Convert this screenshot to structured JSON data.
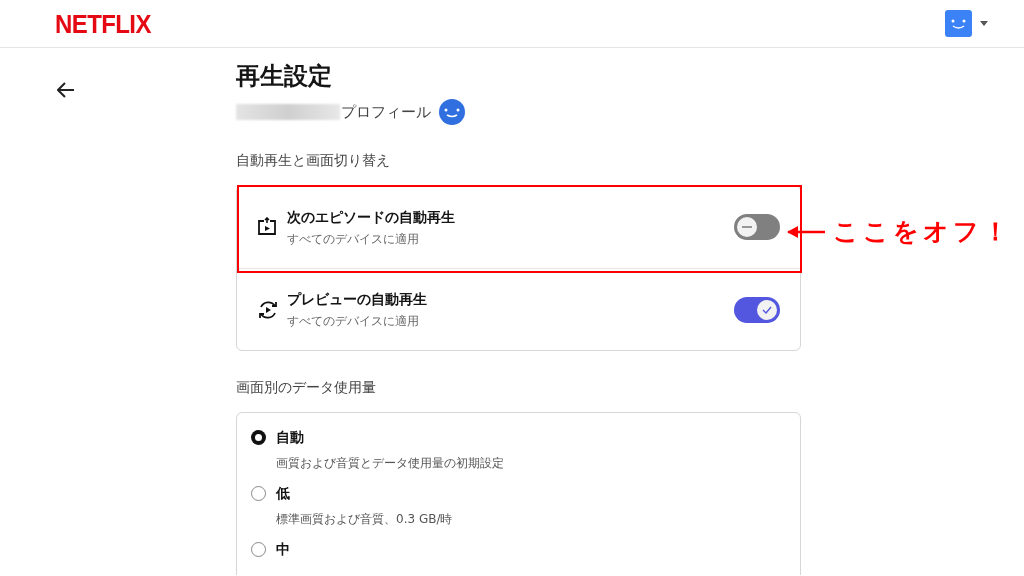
{
  "header": {
    "logo": "NETFLIX"
  },
  "page": {
    "title": "再生設定",
    "profile_label": "プロフィール"
  },
  "sections": [
    {
      "kind": "toggles",
      "heading": "自動再生と画面切り替え",
      "items": [
        {
          "title": "次のエピソードの自動再生",
          "subtitle": "すべてのデバイスに適用",
          "on": false,
          "highlighted": true
        },
        {
          "title": "プレビューの自動再生",
          "subtitle": "すべてのデバイスに適用",
          "on": true,
          "highlighted": false
        }
      ]
    },
    {
      "kind": "radios",
      "heading": "画面別のデータ使用量",
      "options": [
        {
          "label": "自動",
          "description": "画質および音質とデータ使用量の初期設定",
          "selected": true
        },
        {
          "label": "低",
          "description": "標準画質および音質、0.3 GB/時",
          "selected": false
        },
        {
          "label": "中",
          "selected": false
        }
      ]
    }
  ],
  "annotation": {
    "text": "ここをオフ！"
  }
}
